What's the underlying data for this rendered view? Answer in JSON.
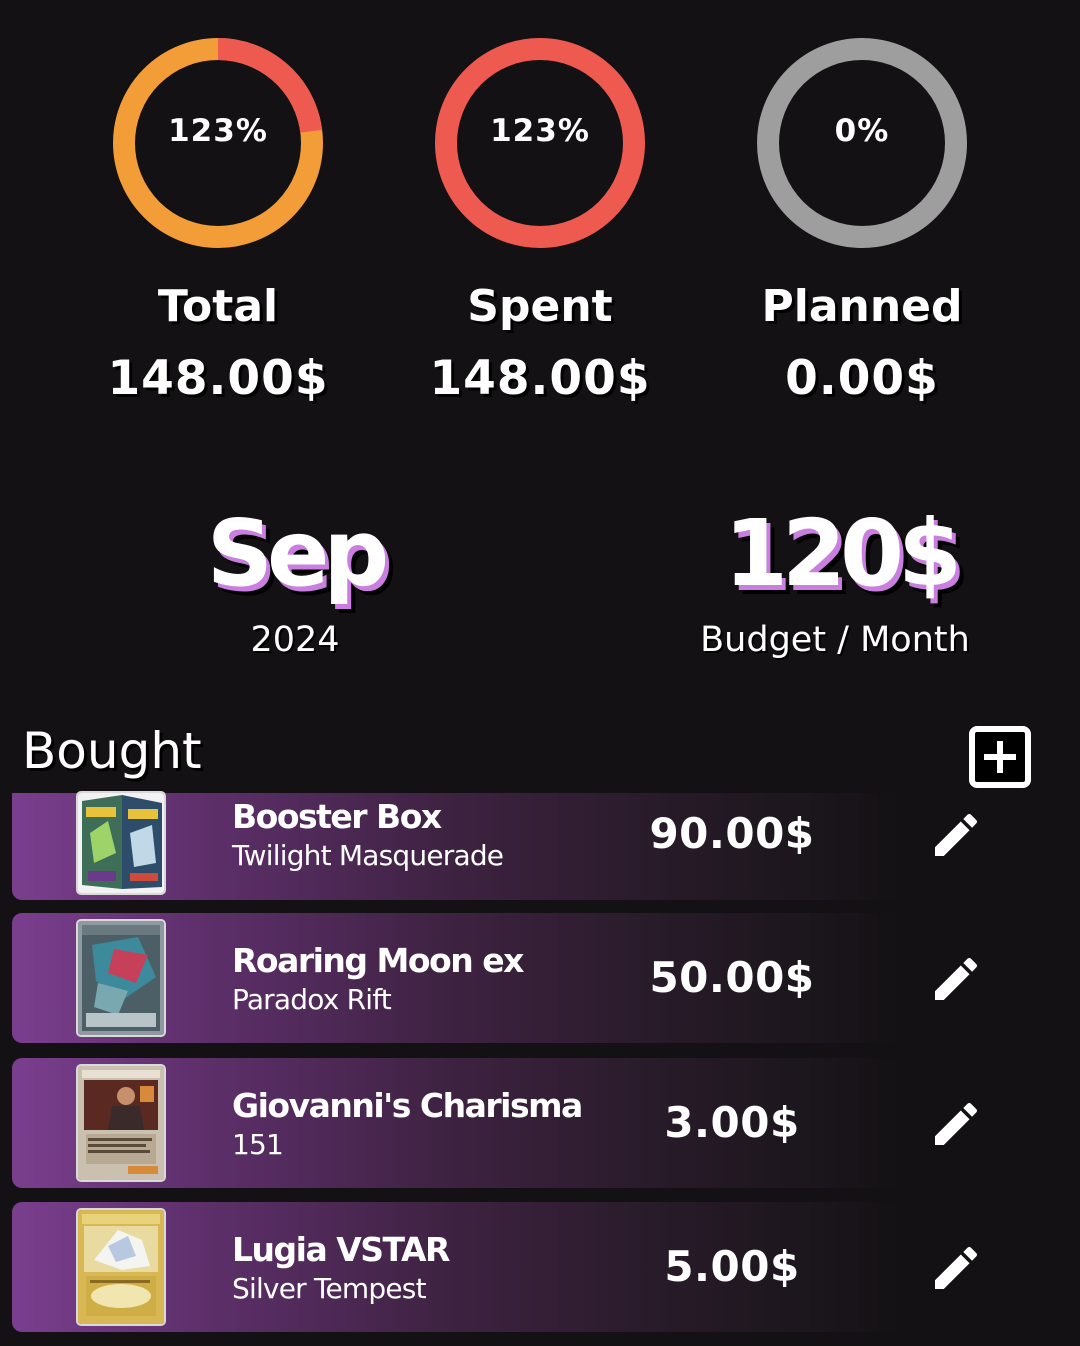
{
  "colors": {
    "background": "#131113",
    "total_ring": "#f29d38",
    "total_overflow": "#ee5a50",
    "spent_ring": "#ee5a50",
    "planned_ring": "#9e9e9e",
    "accent_purple": "#c97ee0",
    "row_purple": "#7a3e8e"
  },
  "stats": {
    "total": {
      "percent_label": "123%",
      "progress": 1.23,
      "label": "Total",
      "value": "148.00$"
    },
    "spent": {
      "percent_label": "123%",
      "progress": 1.23,
      "label": "Spent",
      "value": "148.00$"
    },
    "planned": {
      "percent_label": "0%",
      "progress": 0.0,
      "label": "Planned",
      "value": "0.00$"
    }
  },
  "period": {
    "month": "Sep",
    "year": "2024"
  },
  "budget": {
    "amount": "120$",
    "label": "Budget / Month"
  },
  "bought": {
    "title": "Bought",
    "add_icon": "plus-square-icon",
    "items": [
      {
        "name": "Booster Box",
        "set": "Twilight Masquerade",
        "price": "90.00$",
        "thumb": "booster-box",
        "edit_icon": "pencil-icon"
      },
      {
        "name": "Roaring Moon ex",
        "set": "Paradox Rift",
        "price": "50.00$",
        "thumb": "card-roaring-moon",
        "edit_icon": "pencil-icon"
      },
      {
        "name": "Giovanni's Charisma",
        "set": "151",
        "price": "3.00$",
        "thumb": "card-giovanni",
        "edit_icon": "pencil-icon"
      },
      {
        "name": "Lugia VSTAR",
        "set": "Silver Tempest",
        "price": "5.00$",
        "thumb": "card-lugia",
        "edit_icon": "pencil-icon"
      }
    ]
  }
}
